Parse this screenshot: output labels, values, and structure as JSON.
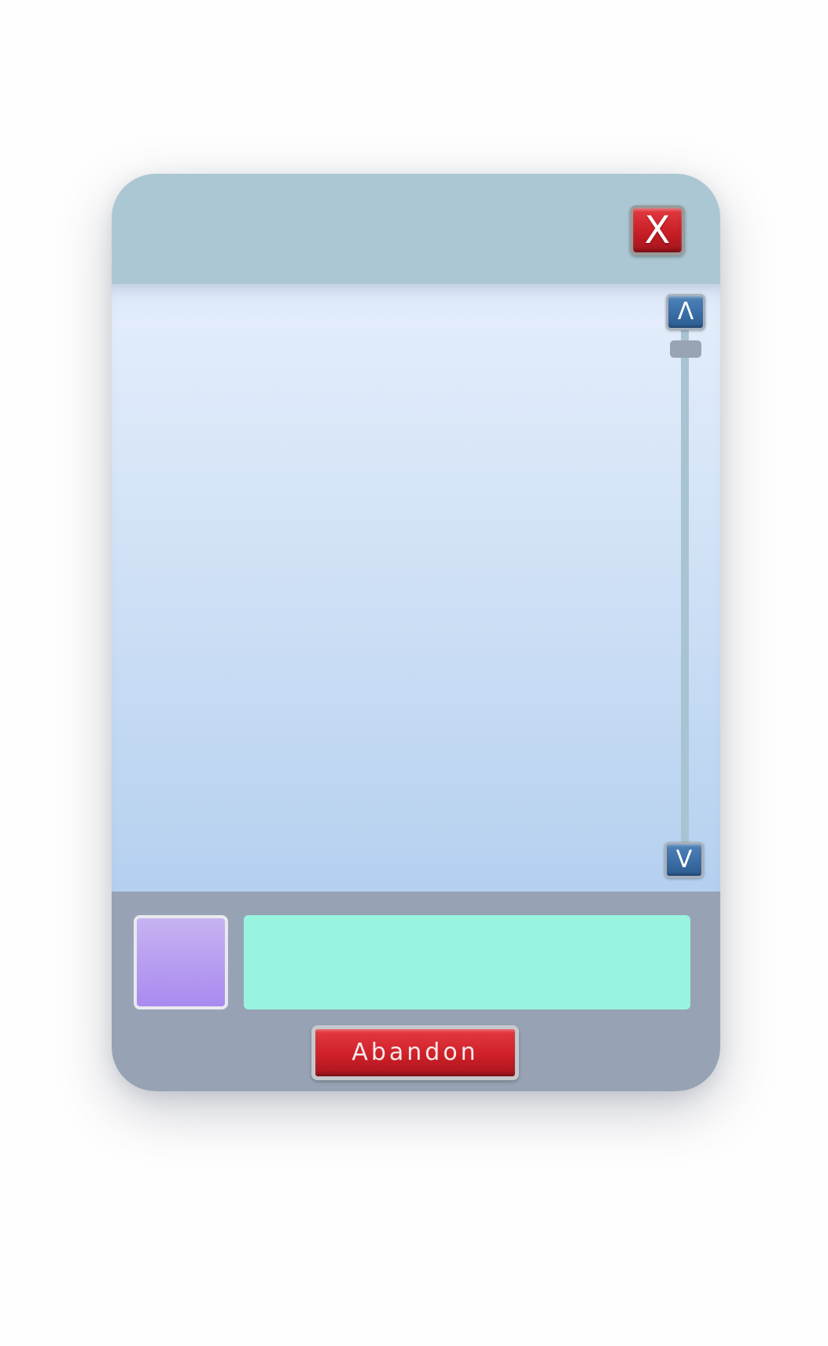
{
  "dialog": {
    "close_label": "X"
  },
  "scrollbar": {
    "up_label": "Λ",
    "down_label": "V"
  },
  "footer": {
    "input_value": "",
    "input_placeholder": "",
    "abandon_label": "Abandon"
  },
  "colors": {
    "titlebar": "#abc7d3",
    "close_button": "#c81e26",
    "content_top": "#e2ecfa",
    "content_bottom": "#b4d0ef",
    "scroll_button": "#3a6ea6",
    "footer": "#97a3b5",
    "swatch_top": "#c6b3f1",
    "swatch_bottom": "#a98af0",
    "input_background": "#98f4df",
    "abandon_button": "#cf2029"
  },
  "icons": {
    "close": "close-icon",
    "scroll_up": "chevron-up-icon",
    "scroll_down": "chevron-down-icon"
  }
}
